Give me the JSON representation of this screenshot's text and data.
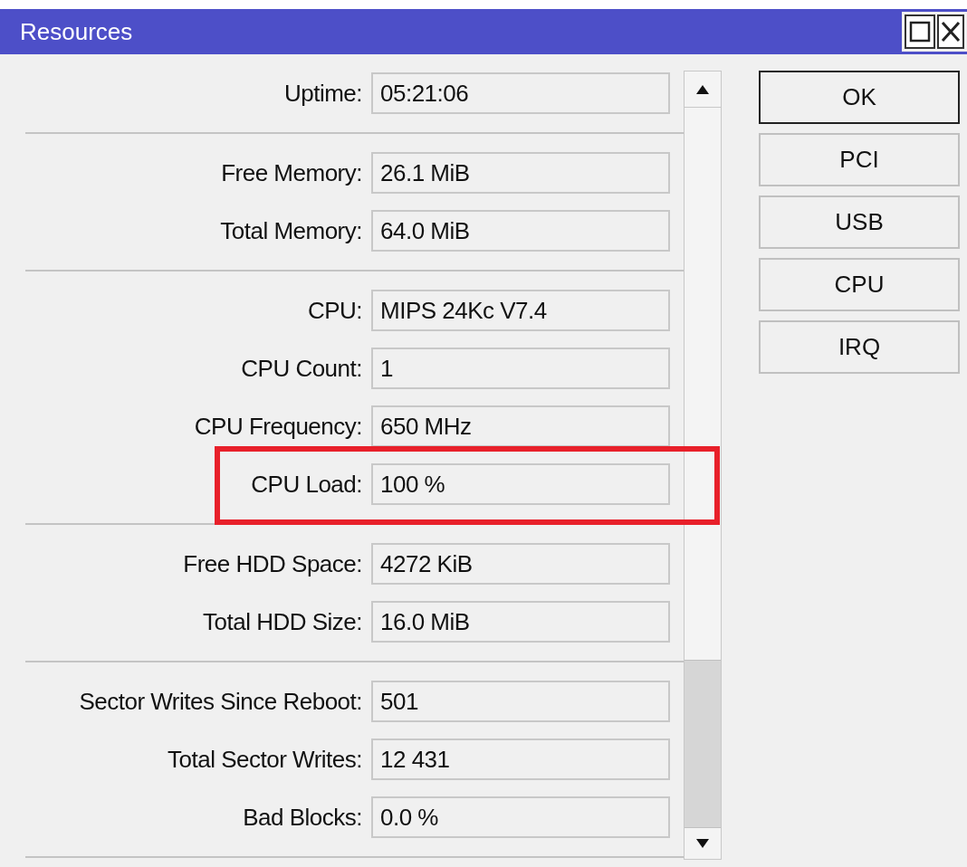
{
  "window": {
    "title": "Resources"
  },
  "sections": [
    [
      {
        "label": "Uptime:",
        "value": "05:21:06",
        "highlighted": false
      }
    ],
    [
      {
        "label": "Free Memory:",
        "value": "26.1 MiB",
        "highlighted": false
      },
      {
        "label": "Total Memory:",
        "value": "64.0 MiB",
        "highlighted": false
      }
    ],
    [
      {
        "label": "CPU:",
        "value": "MIPS 24Kc V7.4",
        "highlighted": false
      },
      {
        "label": "CPU Count:",
        "value": "1",
        "highlighted": false
      },
      {
        "label": "CPU Frequency:",
        "value": "650 MHz",
        "highlighted": false
      },
      {
        "label": "CPU Load:",
        "value": "100 %",
        "highlighted": true
      }
    ],
    [
      {
        "label": "Free HDD Space:",
        "value": "4272 KiB",
        "highlighted": false
      },
      {
        "label": "Total HDD Size:",
        "value": "16.0 MiB",
        "highlighted": false
      }
    ],
    [
      {
        "label": "Sector Writes Since Reboot:",
        "value": "501",
        "highlighted": false
      },
      {
        "label": "Total Sector Writes:",
        "value": "12 431",
        "highlighted": false
      },
      {
        "label": "Bad Blocks:",
        "value": "0.0 %",
        "highlighted": false
      }
    ]
  ],
  "buttons": [
    {
      "label": "OK",
      "default": true
    },
    {
      "label": "PCI",
      "default": false
    },
    {
      "label": "USB",
      "default": false
    },
    {
      "label": "CPU",
      "default": false
    },
    {
      "label": "IRQ",
      "default": false
    }
  ]
}
